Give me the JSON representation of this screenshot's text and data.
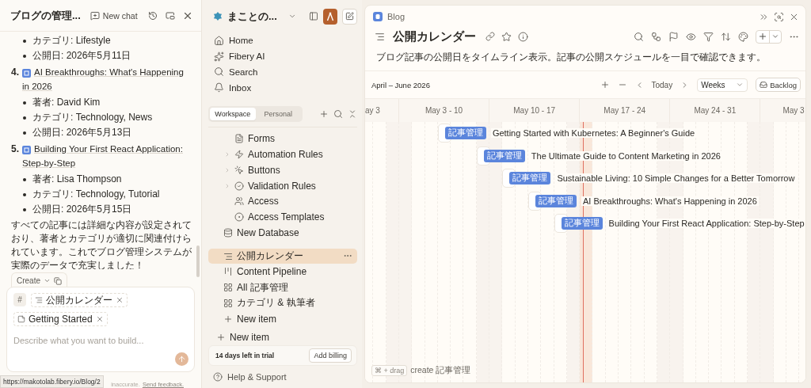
{
  "chat": {
    "title": "ブログの管理...",
    "new_chat": "New chat",
    "top_bullets": [
      "カテゴリ: Lifestyle",
      "公開日: 2026年5月11日"
    ],
    "articles": [
      {
        "number": "4.",
        "title": "AI Breakthroughs: What's Happening in 2026",
        "bullets": [
          "著者: David Kim",
          "カテゴリ: Technology, News",
          "公開日: 2026年5月13日"
        ]
      },
      {
        "number": "5.",
        "title": "Building Your First React Application: Step-by-Step",
        "bullets": [
          "著者: Lisa Thompson",
          "カテゴリ: Technology, Tutorial",
          "公開日: 2026年5月15日"
        ]
      }
    ],
    "summary": "すべての記事には詳細な内容が設定されており、著者とカテゴリが適切に関連付けられています。これでブログ管理システムが実際のデータで充実しました！",
    "create_button": "Create",
    "composer": {
      "hash": "#",
      "tags": [
        {
          "label": "公開カレンダー",
          "kind": "view"
        },
        {
          "label": "Getting Started",
          "kind": "page"
        }
      ],
      "placeholder": "Describe what you want to build..."
    },
    "footer": {
      "note": "inaccurate.",
      "link": "Send feedback."
    },
    "status_url": "https://makotolab.fibery.io/Blog/2"
  },
  "sidebar": {
    "workspace": "まことの...",
    "nav": [
      "Home",
      "Fibery AI",
      "Search",
      "Inbox"
    ],
    "tabs": [
      {
        "label": "Workspace",
        "selected": true
      },
      {
        "label": "Personal",
        "selected": false
      }
    ],
    "settings_items": [
      {
        "label": "Forms",
        "expandable": false
      },
      {
        "label": "Automation Rules",
        "expandable": true
      },
      {
        "label": "Buttons",
        "expandable": true
      },
      {
        "label": "Validation Rules",
        "expandable": true
      },
      {
        "label": "Access",
        "expandable": false
      },
      {
        "label": "Access Templates",
        "expandable": false
      }
    ],
    "database_items": [
      {
        "label": "New Database",
        "selected": false
      },
      {
        "label": "公開カレンダー",
        "selected": true
      },
      {
        "label": "Content Pipeline",
        "selected": false
      },
      {
        "label": "All 記事管理",
        "selected": false
      },
      {
        "label": "カテゴリ & 執筆者",
        "selected": false
      },
      {
        "label": "New item",
        "selected": false
      }
    ],
    "root_items": [
      "New item"
    ],
    "trial": {
      "text": "14 days left in trial",
      "button": "Add billing"
    },
    "help": "Help & Support"
  },
  "main": {
    "breadcrumb": "Blog",
    "title": "公開カレンダー",
    "description": "ブログ記事の公開日をタイムライン表示。記事の公開スケジュールを一目で確認できます。",
    "range": "April – June 2026",
    "today": "Today",
    "scale": "Weeks",
    "backlog": "Backlog",
    "timeline": {
      "weeks": [
        "ay 3",
        "May 3 - 10",
        "May 10 - 17",
        "May 17 - 24",
        "May 24 - 31",
        "May 3"
      ],
      "items": [
        {
          "tag": "記事管理",
          "title": "Getting Started with Kubernetes: A Beginner's Guide"
        },
        {
          "tag": "記事管理",
          "title": "The Ultimate Guide to Content Marketing in 2026"
        },
        {
          "tag": "記事管理",
          "title": "Sustainable Living: 10 Simple Changes for a Better Tomorrow"
        },
        {
          "tag": "記事管理",
          "title": "AI Breakthroughs: What's Happening in 2026"
        },
        {
          "tag": "記事管理",
          "title": "Building Your First React Application: Step-by-Step"
        }
      ]
    },
    "hint": {
      "key": "⌘ + drag",
      "text": "create 記事管理"
    }
  }
}
